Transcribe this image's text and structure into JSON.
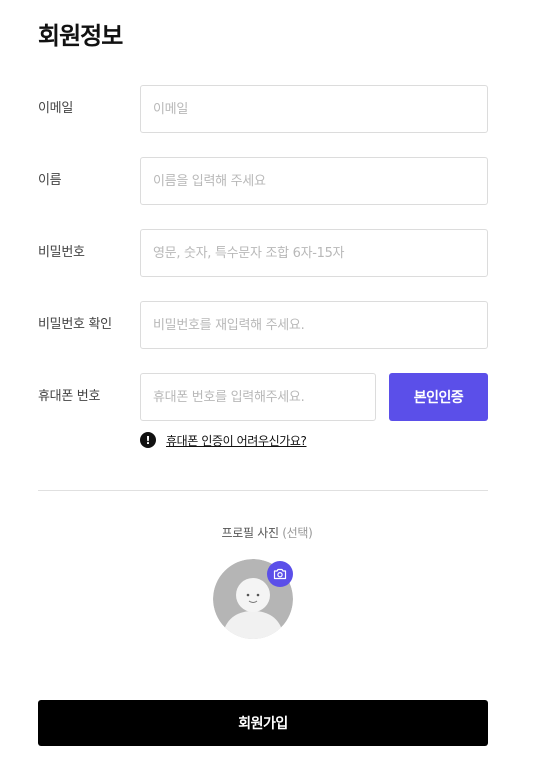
{
  "page": {
    "title": "회원정보"
  },
  "form": {
    "fields": [
      {
        "label": "이메일",
        "placeholder": "이메일",
        "value": ""
      },
      {
        "label": "이름",
        "placeholder": "이름을 입력해 주세요",
        "value": ""
      },
      {
        "label": "비밀번호",
        "placeholder": "영문, 숫자, 특수문자 조합 6자-15자",
        "value": ""
      },
      {
        "label": "비밀번호 확인",
        "placeholder": "비밀번호를 재입력해 주세요.",
        "value": ""
      },
      {
        "label": "휴대폰 번호",
        "placeholder": "휴대폰 번호를 입력해주세요.",
        "value": ""
      }
    ],
    "verify_button": "본인인증",
    "help_icon": "!",
    "help_link": "휴대폰 인증이 어려우신가요?"
  },
  "profile": {
    "label": "프로필 사진",
    "optional": "(선택)",
    "avatar_icon": "avatar-placeholder-icon",
    "camera_icon": "camera-icon"
  },
  "submit": {
    "label": "회원가입"
  },
  "colors": {
    "accent": "#5b4fe9",
    "submit_bg": "#000000",
    "border": "#dcdcdc",
    "divider": "#e0e0e0",
    "avatar_bg": "#b5b5b5"
  }
}
